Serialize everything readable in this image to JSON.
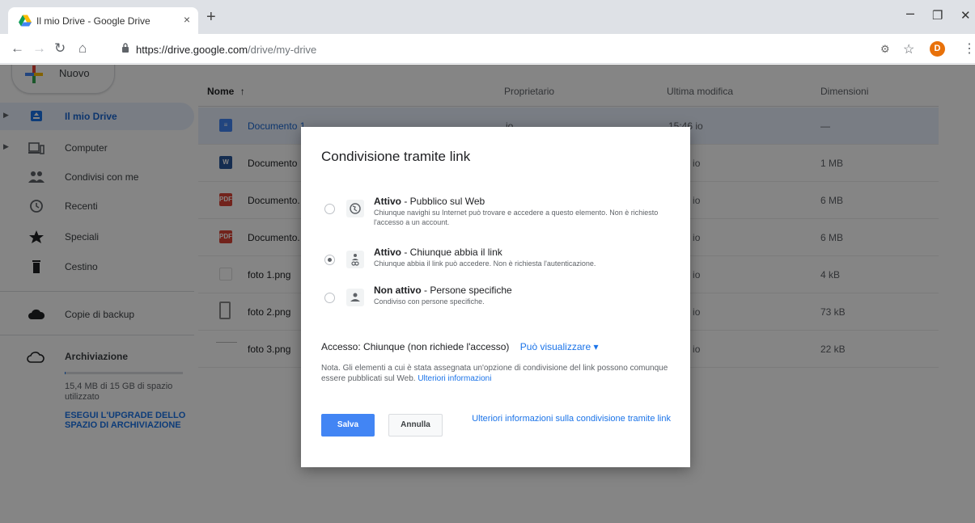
{
  "browser": {
    "tab_title": "Il mio Drive - Google Drive",
    "tab_close": "×",
    "new_tab": "+",
    "url_host": "https://drive.google.com",
    "url_path": "/drive/my-drive",
    "avatar_letter": "D",
    "window_controls": {
      "minimize": "–",
      "maximize": "❐",
      "close": "✕"
    }
  },
  "sidebar": {
    "new_button": "Nuovo",
    "items": [
      {
        "label": "Il mio Drive",
        "icon": "my-drive-icon",
        "active": true
      },
      {
        "label": "Computer",
        "icon": "computer-icon",
        "active": false
      },
      {
        "label": "Condivisi con me",
        "icon": "shared-icon",
        "active": false
      },
      {
        "label": "Recenti",
        "icon": "clock-icon",
        "active": false
      },
      {
        "label": "Speciali",
        "icon": "star-icon",
        "active": false
      },
      {
        "label": "Cestino",
        "icon": "trash-icon",
        "active": false
      },
      {
        "label": "Copie di backup",
        "icon": "cloud-icon",
        "active": false
      }
    ],
    "storage": {
      "title": "Archiviazione",
      "used_text": "15,4 MB di 15 GB di spazio utilizzato",
      "used_fraction": 0.01,
      "upgrade_link": "ESEGUI L'UPGRADE DELLO SPAZIO DI ARCHIVIAZIONE"
    }
  },
  "file_list": {
    "columns": {
      "name": "Nome",
      "sort_arrow": "↑",
      "owner": "Proprietario",
      "modified": "Ultima modifica",
      "size": "Dimensioni"
    },
    "rows": [
      {
        "name": "Documento 1",
        "type": "doc",
        "owner": "io",
        "modified": "15:46 io",
        "size": "—",
        "selected": true
      },
      {
        "name": "Documento",
        "type": "word",
        "owner": "",
        "modified": "2018 io",
        "size": "1 MB",
        "selected": false
      },
      {
        "name": "Documento.",
        "type": "pdf",
        "owner": "",
        "modified": "2018 io",
        "size": "6 MB",
        "selected": false
      },
      {
        "name": "Documento.",
        "type": "pdf",
        "owner": "",
        "modified": "2018 io",
        "size": "6 MB",
        "selected": false
      },
      {
        "name": "foto 1.png",
        "type": "image",
        "owner": "",
        "modified": "2018 io",
        "size": "4 kB",
        "selected": false
      },
      {
        "name": "foto 2.png",
        "type": "image",
        "owner": "",
        "modified": "2018 io",
        "size": "73 kB",
        "selected": false
      },
      {
        "name": "foto 3.png",
        "type": "image",
        "owner": "",
        "modified": "2018 io",
        "size": "22 kB",
        "selected": false
      }
    ]
  },
  "dialog": {
    "title": "Condivisione tramite link",
    "options": [
      {
        "title_bold": "Attivo",
        "title_rest": " - Pubblico sul Web",
        "desc": "Chiunque navighi su Internet può trovare e accedere a questo elemento. Non è richiesto l'accesso a un account.",
        "icon": "globe-icon",
        "checked": false
      },
      {
        "title_bold": "Attivo",
        "title_rest": " - Chiunque abbia il link",
        "desc": "Chiunque abbia il link può accedere. Non è richiesta l'autenticazione.",
        "icon": "link-person-icon",
        "checked": true
      },
      {
        "title_bold": "Non attivo",
        "title_rest": " - Persone specifiche",
        "desc": "Condiviso con persone specifiche.",
        "icon": "person-icon",
        "checked": false
      }
    ],
    "access_label": "Accesso:",
    "access_value": "Chiunque (non richiede l'accesso)",
    "access_permission": "Può visualizzare ▾",
    "note_text": "Nota. Gli elementi a cui è stata assegnata un'opzione di condivisione del link possono comunque essere pubblicati sul Web.",
    "note_link": "Ulteriori informazioni",
    "save_label": "Salva",
    "cancel_label": "Annulla",
    "more_info_link": "Ulteriori informazioni sulla condivisione tramite link"
  },
  "colors": {
    "accent": "#1a73e8",
    "save_button": "#4285f4",
    "selected_row": "#e8f0fe"
  }
}
